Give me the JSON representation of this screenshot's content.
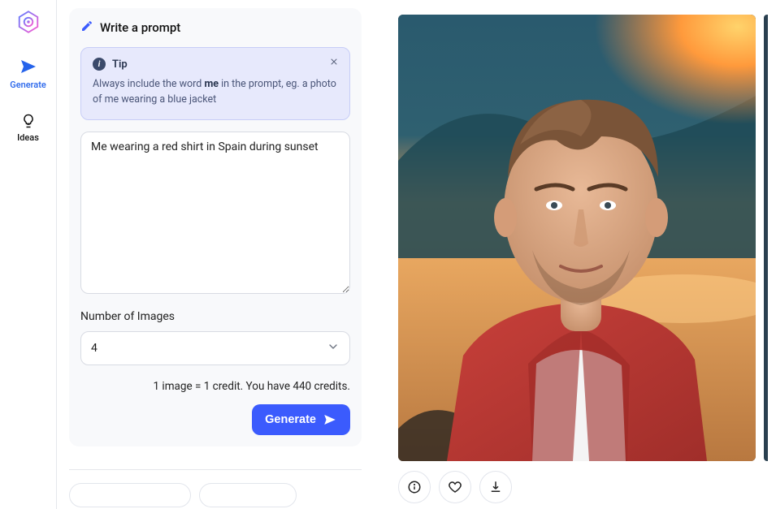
{
  "sidebar": {
    "items": [
      {
        "label": "Generate"
      },
      {
        "label": "Ideas"
      }
    ]
  },
  "panel": {
    "header": "Write a prompt",
    "tip": {
      "title": "Tip",
      "body_pre": "Always include the word ",
      "body_bold": "me",
      "body_post": " in the prompt, eg. a photo of me wearing a blue jacket"
    },
    "prompt_value": "Me wearing a red shirt in Spain during sunset",
    "num_images_label": "Number of Images",
    "num_images_value": "4",
    "credits_line": "1 image = 1 credit. You have 440 credits.",
    "generate_label": "Generate"
  }
}
